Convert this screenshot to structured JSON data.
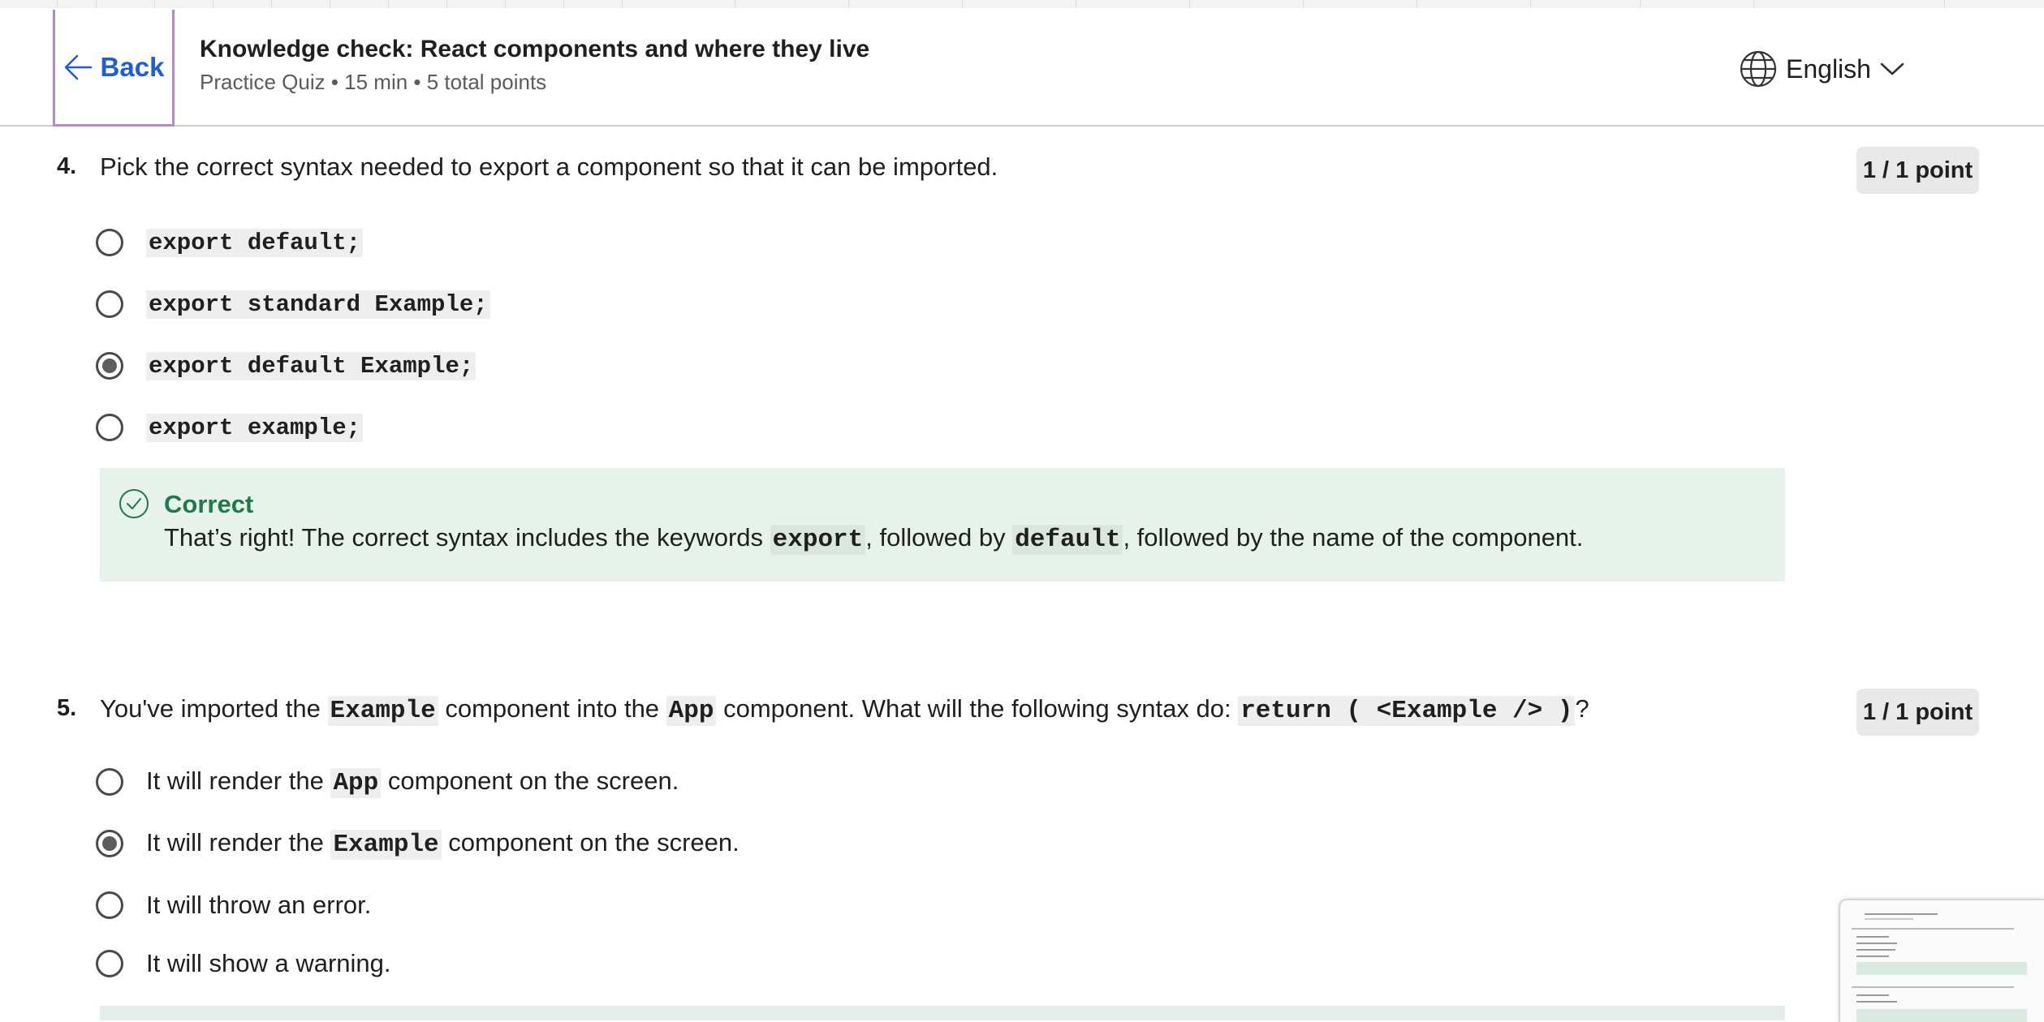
{
  "header": {
    "back_label": "Back",
    "title": "Knowledge check: React components and where they live",
    "subtitle": "Practice Quiz • 15 min • 5 total points",
    "language": "English"
  },
  "q4": {
    "number": "4.",
    "text": "Pick the correct syntax needed to export a component so that it can be imported.",
    "points": "1 / 1 point",
    "options": [
      {
        "label": "export default;",
        "selected": false
      },
      {
        "label": "export standard Example;",
        "selected": false
      },
      {
        "label": "export default Example;",
        "selected": true
      },
      {
        "label": "export example;",
        "selected": false
      }
    ],
    "feedback": {
      "status": "Correct",
      "text_1": "That’s right! The correct syntax includes the keywords ",
      "code_1": "export",
      "text_2": ", followed by ",
      "code_2": "default",
      "text_3": ", followed by the name of the component."
    }
  },
  "q5": {
    "number": "5.",
    "text_1": "You've imported the ",
    "code_1": "Example",
    "text_2": " component into the ",
    "code_2": "App",
    "text_3": " component. What will the following syntax do: ",
    "code_3": "return ( <Example /> )",
    "text_4": "?",
    "points": "1 / 1 point",
    "options": [
      {
        "pre": "It will render the ",
        "code": "App",
        "post": " component on the screen.",
        "selected": false
      },
      {
        "pre": "It will render the ",
        "code": "Example",
        "post": " component on the screen.",
        "selected": true
      },
      {
        "pre": "It will throw an error.",
        "code": "",
        "post": "",
        "selected": false
      },
      {
        "pre": "It will show a warning.",
        "code": "",
        "post": "",
        "selected": false
      }
    ]
  },
  "colors": {
    "link": "#1f5fd1",
    "correct": "#1e7a46",
    "feedback_bg": "#e8f2ec",
    "focus_outline": "#b48cc4"
  },
  "icons": {
    "back": "arrow-left-icon",
    "language": "globe-icon",
    "dropdown": "chevron-down-icon",
    "correct": "check-circle-icon"
  }
}
